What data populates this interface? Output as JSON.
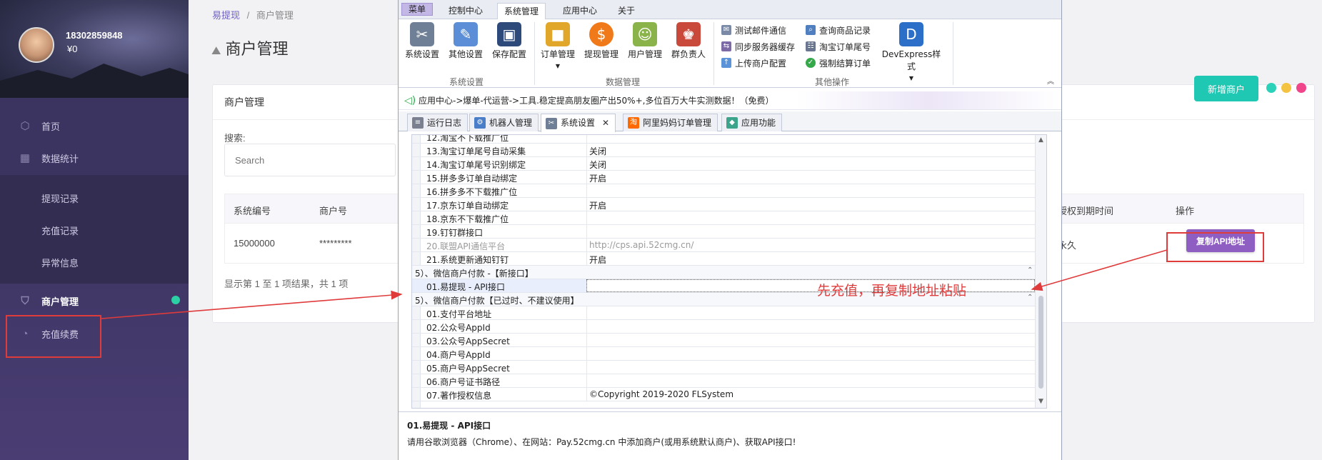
{
  "sidebar": {
    "user_name": "18302859848",
    "balance": "¥0",
    "items": [
      {
        "label": "首页",
        "icon": "cube-icon"
      },
      {
        "label": "数据统计",
        "icon": "grid-icon"
      },
      {
        "label": "提现记录"
      },
      {
        "label": "充值记录"
      },
      {
        "label": "异常信息"
      },
      {
        "label": "商户管理",
        "icon": "shield-icon"
      },
      {
        "label": "充值续费",
        "icon": "pie-icon"
      }
    ]
  },
  "web": {
    "breadcrumb_home": "易提现",
    "breadcrumb_sep": "/",
    "breadcrumb_current": "商户管理",
    "page_title": "商户管理",
    "card_title": "商户管理",
    "search_label": "搜索:",
    "search_placeholder": "Search",
    "add_button": "新增商户",
    "columns": {
      "id": "系统编号",
      "merchant": "商户号",
      "expire": "授权到期时间",
      "actions": "操作"
    },
    "row": {
      "id": "15000000",
      "merchant": "*********",
      "expire": "永久"
    },
    "copy_api_button": "复制API地址",
    "footer": "显示第 1 至 1 项结果，共 1 项",
    "accent": "#8e5ec2",
    "teal": "#1ec8b2"
  },
  "app": {
    "menu_tabs": [
      "菜单",
      "控制中心",
      "系统管理",
      "应用中心",
      "关于"
    ],
    "ribbon": {
      "system_group": {
        "label": "系统设置",
        "buttons": [
          "系统设置",
          "其他设置",
          "保存配置"
        ]
      },
      "data_group": {
        "label": "数据管理",
        "buttons": [
          "订单管理",
          "提现管理",
          "用户管理",
          "群负责人"
        ]
      },
      "other_group": {
        "label": "其他操作",
        "small_buttons": [
          "测试邮件通信",
          "同步服务器缓存",
          "上传商户配置",
          "查询商品记录",
          "淘宝订单尾号",
          "强制结算订单"
        ],
        "devexpress": "DevExpress样式"
      }
    },
    "notice": "应用中心->爆单-代运营->工具.稳定提高朋友圈产出50%+,多位百万大牛实测数据！（免费）",
    "doc_tabs": [
      "运行日志",
      "机器人管理",
      "系统设置",
      "阿里妈妈订单管理",
      "应用功能"
    ],
    "grid_rows": [
      {
        "key": "12.淘宝不下载推广位",
        "value": ""
      },
      {
        "key": "13.淘宝订单尾号自动采集",
        "value": "关闭"
      },
      {
        "key": "14.淘宝订单尾号识别绑定",
        "value": "关闭"
      },
      {
        "key": "15.拼多多订单自动绑定",
        "value": "开启"
      },
      {
        "key": "16.拼多多不下载推广位",
        "value": ""
      },
      {
        "key": "17.京东订单自动绑定",
        "value": "开启"
      },
      {
        "key": "18.京东不下载推广位",
        "value": ""
      },
      {
        "key": "19.钉钉群接口",
        "value": ""
      },
      {
        "key": "20.联盟API通信平台",
        "value": "http://cps.api.52cmg.cn/"
      },
      {
        "key": "21.系统更新通知钉钉",
        "value": "开启"
      },
      {
        "key": "5）、微信商户付款 -【新接口】",
        "value": ""
      },
      {
        "key": "01.易提现 - API接口",
        "value": ""
      },
      {
        "key": "5）、微信商户付款【已过时、不建议使用】",
        "value": ""
      },
      {
        "key": "01.支付平台地址",
        "value": ""
      },
      {
        "key": "02.公众号AppId",
        "value": ""
      },
      {
        "key": "03.公众号AppSecret",
        "value": ""
      },
      {
        "key": "04.商户号AppId",
        "value": ""
      },
      {
        "key": "05.商户号AppSecret",
        "value": ""
      },
      {
        "key": "06.商户号证书路径",
        "value": ""
      },
      {
        "key": "07.著作授权信息",
        "value": "©Copyright 2019-2020 FLSystem"
      }
    ],
    "desc_title": "01.易提现 - API接口",
    "desc_text": "请用谷歌浏览器（Chrome）、在网站：Pay.52cmg.cn 中添加商户(或用系统默认商户)、获取API接口!"
  },
  "annotation": {
    "hint": "先充值，再复制地址粘贴",
    "color": "#e03b3b"
  }
}
